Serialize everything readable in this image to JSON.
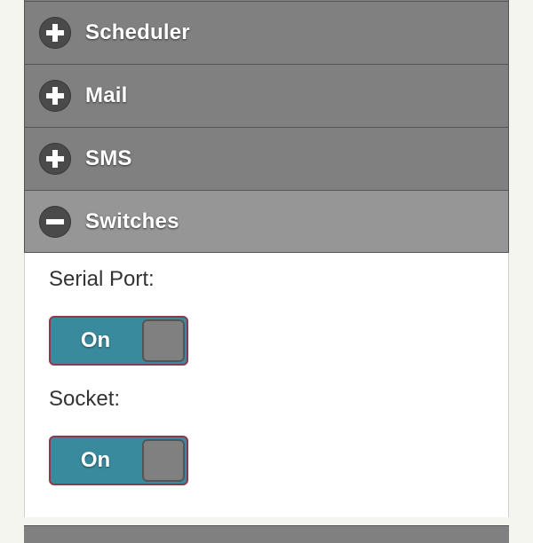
{
  "accordion": {
    "sections": [
      {
        "label": "",
        "icon": "plus-icon",
        "state": "collapsed"
      },
      {
        "label": "Scheduler",
        "icon": "plus-icon",
        "state": "collapsed"
      },
      {
        "label": "Mail",
        "icon": "plus-icon",
        "state": "collapsed"
      },
      {
        "label": "SMS",
        "icon": "plus-icon",
        "state": "collapsed"
      },
      {
        "label": "Switches",
        "icon": "minus-icon",
        "state": "expanded"
      }
    ]
  },
  "switches": {
    "serial_port": {
      "label": "Serial Port:",
      "toggle_label": "On",
      "value": "on"
    },
    "socket": {
      "label": "Socket:",
      "toggle_label": "On",
      "value": "on"
    }
  },
  "colors": {
    "header_bg": "#808080",
    "header_expanded_bg": "#969696",
    "toggle_on_bg": "#3a8a9e",
    "toggle_border": "#8a3a4a",
    "page_bg": "#f5f5ef"
  }
}
